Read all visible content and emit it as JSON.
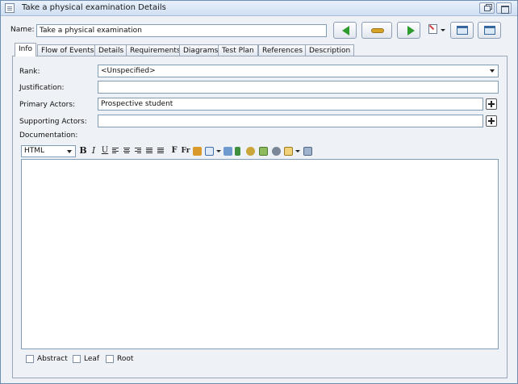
{
  "window": {
    "title": "Take a physical examination Details"
  },
  "name_field": {
    "label": "Name:",
    "value": "Take a physical examination"
  },
  "header_buttons": [
    "back-arrow-icon",
    "link-icon",
    "forward-arrow-icon",
    "note-icon",
    "dropdown-caret-icon",
    "fit-window-icon",
    "window-icon"
  ],
  "tabs": [
    "Info",
    "Flow of Events",
    "Details",
    "Requirements",
    "Diagrams",
    "Test Plan",
    "References",
    "Description"
  ],
  "active_tab": "Info",
  "info": {
    "rank_label": "Rank:",
    "rank_value": "<Unspecified>",
    "justification_label": "Justification:",
    "justification_value": "",
    "primary_actors_label": "Primary Actors:",
    "primary_actors_value": "Prospective student",
    "supporting_actors_label": "Supporting Actors:",
    "supporting_actors_value": "",
    "documentation_label": "Documentation:"
  },
  "toolbar": {
    "format_value": "HTML",
    "bold": "B",
    "italic": "I",
    "underline": "U",
    "font": "F",
    "font_size": "Fr"
  },
  "toolbar_icons": [
    "bold-icon",
    "italic-icon",
    "underline-icon",
    "align-left-icon",
    "align-center-icon",
    "align-right-icon",
    "numbered-list-icon",
    "bullet-list-icon",
    "font-icon",
    "font-size-icon",
    "highlight-icon",
    "table-icon",
    "insert-link-icon",
    "anchor-icon",
    "user-icon",
    "image-icon",
    "add-element-icon",
    "insert-object-icon",
    "print-icon"
  ],
  "checkboxes": {
    "abstract": "Abstract",
    "leaf": "Leaf",
    "root": "Root"
  },
  "colors": {
    "accent_green": "#2e9b2e",
    "panel_bg": "#eef1f6",
    "border": "#7f9db9"
  }
}
